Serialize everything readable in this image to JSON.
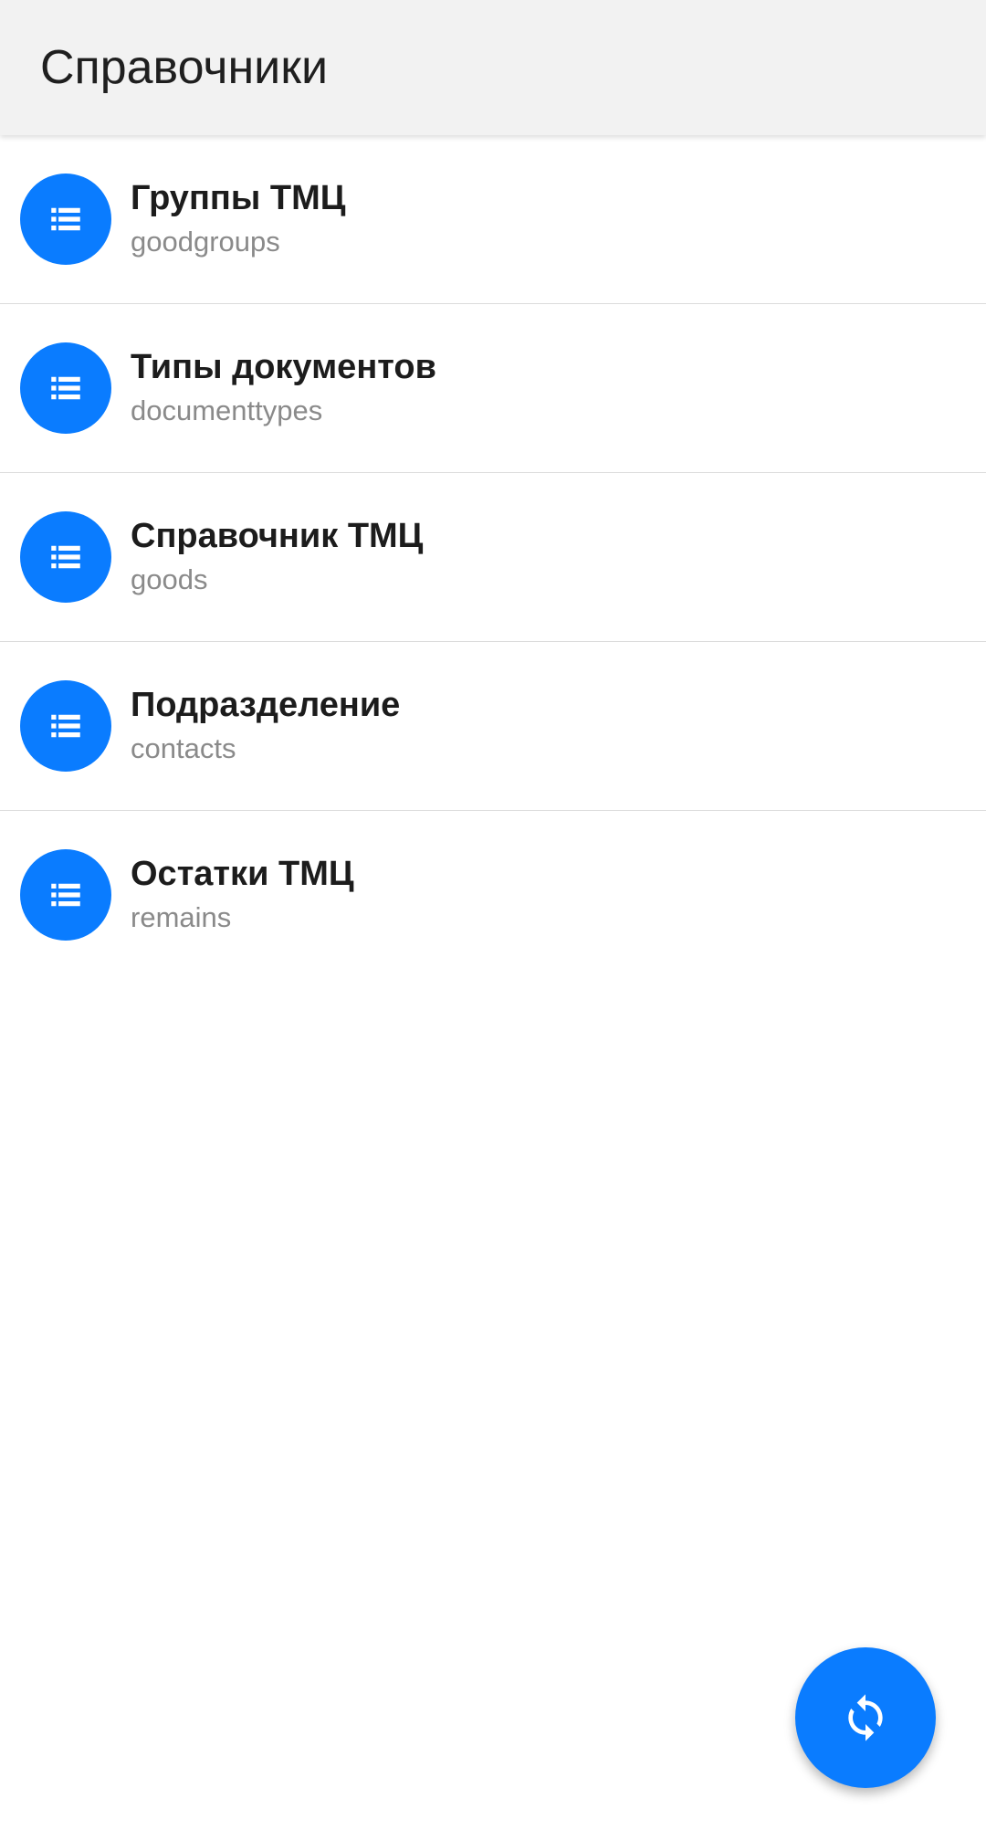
{
  "appbar": {
    "title": "Справочники"
  },
  "colors": {
    "accent": "#0a7cff",
    "appbar_bg": "#f2f2f2",
    "title_text": "#1c1c1c",
    "subtitle_text": "#8a8a8a",
    "divider": "#dcdcdc"
  },
  "list": {
    "items": [
      {
        "title": "Группы ТМЦ",
        "subtitle": "goodgroups",
        "icon": "list-icon"
      },
      {
        "title": "Типы документов",
        "subtitle": "documenttypes",
        "icon": "list-icon"
      },
      {
        "title": "Справочник ТМЦ",
        "subtitle": "goods",
        "icon": "list-icon"
      },
      {
        "title": "Подразделение",
        "subtitle": "contacts",
        "icon": "list-icon"
      },
      {
        "title": "Остатки ТМЦ",
        "subtitle": "remains",
        "icon": "list-icon"
      }
    ]
  },
  "fab": {
    "icon": "sync-icon"
  }
}
